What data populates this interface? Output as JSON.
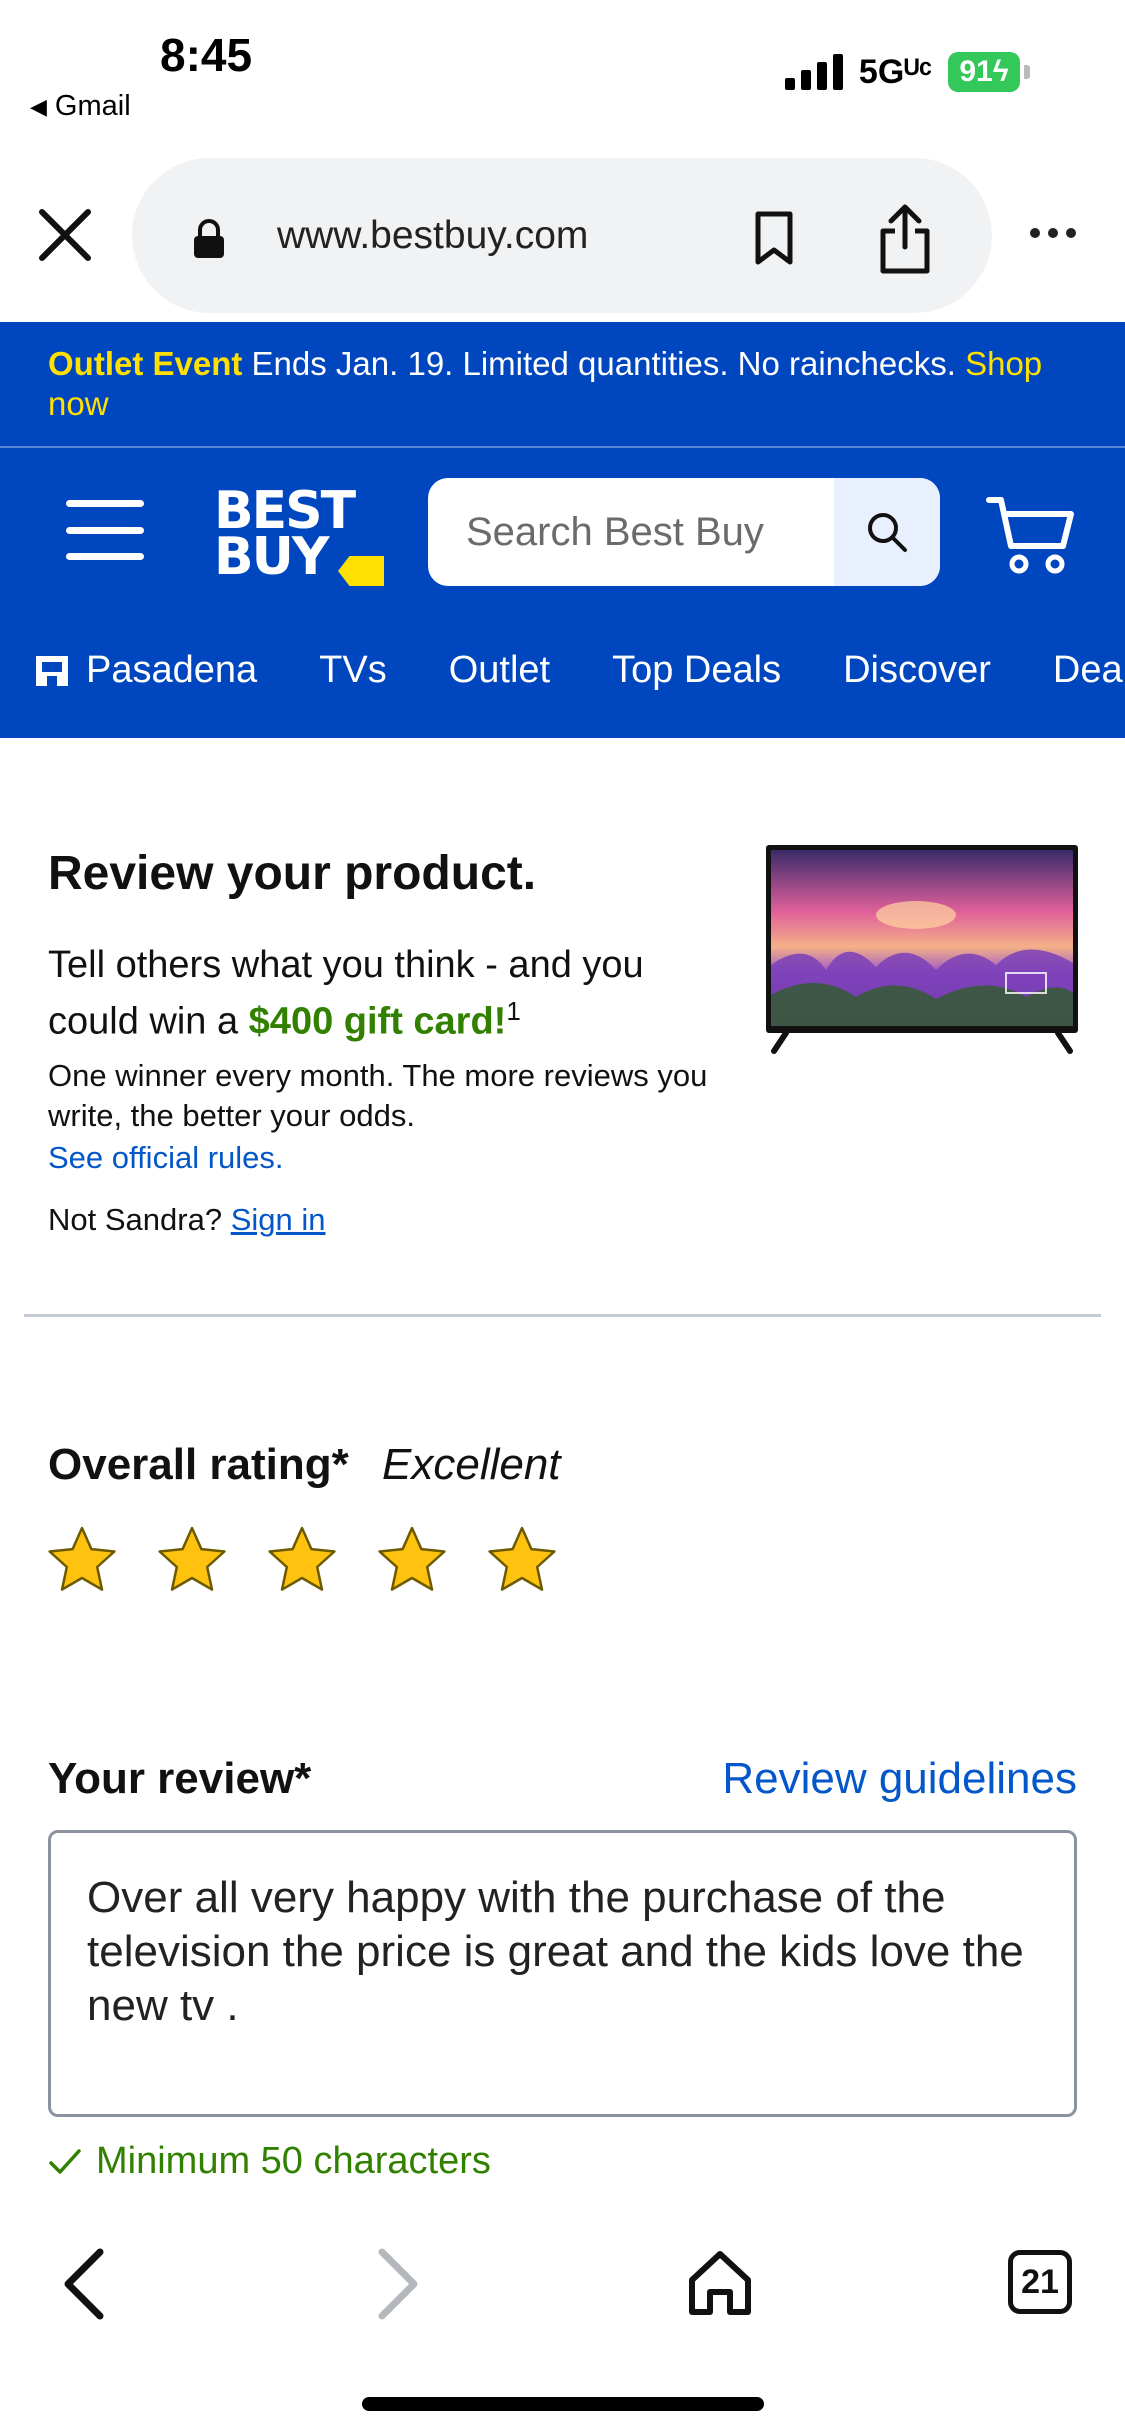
{
  "status_bar": {
    "time": "8:45",
    "back_app": "Gmail",
    "network": "5Gᵁᶜ",
    "battery": "91"
  },
  "browser": {
    "url": "www.bestbuy.com",
    "open_tabs": "21"
  },
  "promo": {
    "event": "Outlet Event",
    "text": "Ends Jan. 19. Limited quantities. No rainchecks.",
    "link": "Shop now"
  },
  "header": {
    "logo_line1": "BEST",
    "logo_line2": "BUY",
    "search_placeholder": "Search Best Buy",
    "nav": [
      "Pasadena",
      "TVs",
      "Outlet",
      "Top Deals",
      "Discover",
      "Deals"
    ]
  },
  "review_promo": {
    "title": "Review your product.",
    "subtitle_pre": "Tell others what you think - and you could win a ",
    "gift": "$400 gift card!",
    "footnote": "1",
    "note": "One winner every month. The more reviews you write, the better your odds.",
    "rules_link": "See official rules.",
    "not_user": "Not Sandra?",
    "sign_in": "Sign in"
  },
  "rating": {
    "label": "Overall rating*",
    "value_text": "Excellent",
    "stars": 5,
    "max_stars": 5
  },
  "review": {
    "label": "Your review*",
    "guidelines_link": "Review guidelines",
    "text": "Over all very happy with the purchase of the television the price is great and the kids love the new tv .",
    "min_chars": "Minimum 50 characters"
  },
  "colors": {
    "brand_blue": "#0046be",
    "brand_yellow": "#ffe000",
    "link_blue": "#0457c8",
    "success_green": "#318000",
    "star_gold": "#ffc20e"
  }
}
